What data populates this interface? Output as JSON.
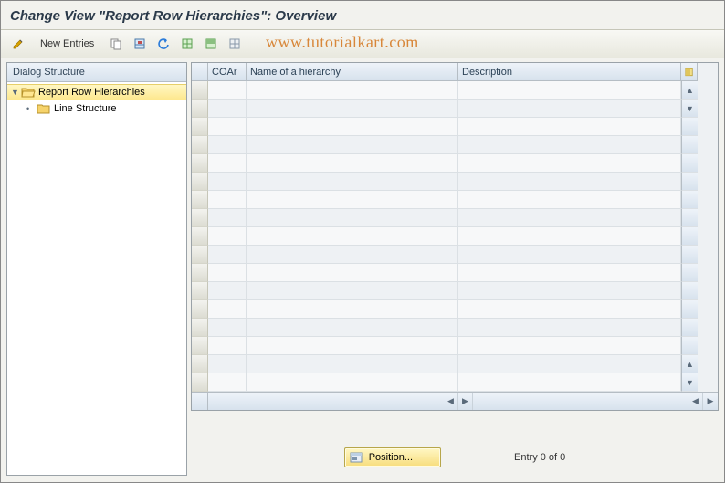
{
  "title": "Change View \"Report Row Hierarchies\": Overview",
  "watermark": "www.tutorialkart.com",
  "toolbar": {
    "new_entries": "New Entries"
  },
  "tree": {
    "header": "Dialog Structure",
    "items": [
      {
        "label": "Report Row Hierarchies",
        "level": 0,
        "open": true,
        "selected": true
      },
      {
        "label": "Line Structure",
        "level": 1,
        "open": false,
        "selected": false
      }
    ]
  },
  "grid": {
    "columns": [
      "COAr",
      "Name of a hierarchy",
      "Description"
    ],
    "rows": 17
  },
  "footer": {
    "position_label": "Position...",
    "entry_text": "Entry 0 of 0"
  }
}
